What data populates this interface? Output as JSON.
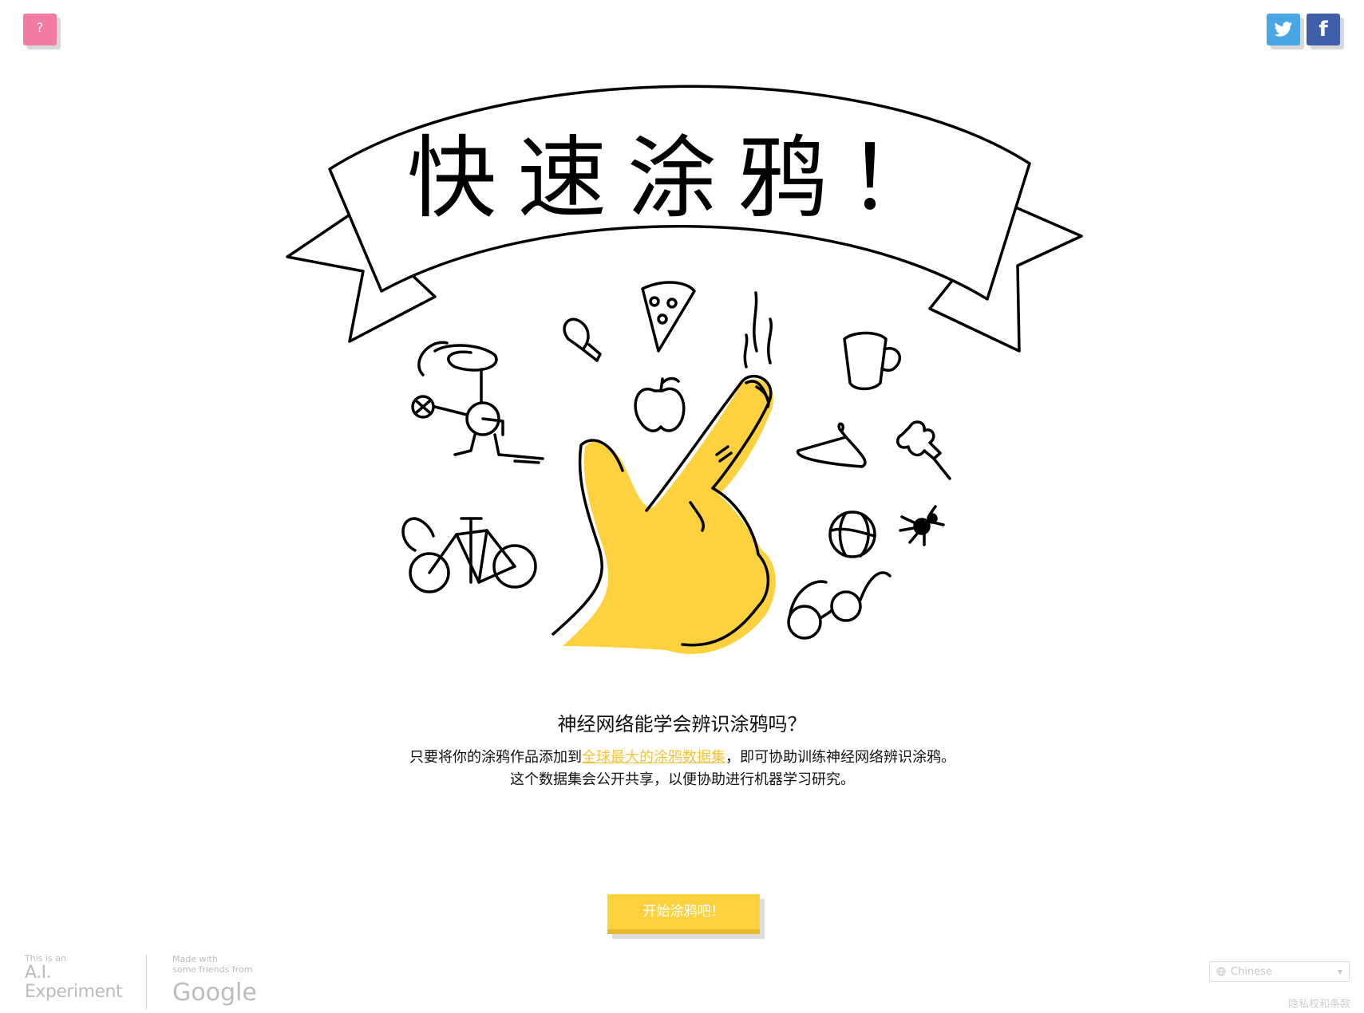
{
  "header": {
    "help_label": "?",
    "facebook_label": "f"
  },
  "hero": {
    "title": "快速涂鸦！"
  },
  "intro": {
    "headline": "神经网络能学会辨识涂鸦吗？",
    "desc_before": "只要将你的涂鸦作品添加到",
    "desc_link": "全球最大的涂鸦数据集",
    "desc_after": "，即可协助训练神经网络辨识涂鸦。这个数据集会公开共享，以便协助进行机器学习研究。"
  },
  "start_button": "开始涂鸦吧！",
  "footer": {
    "ai_small": "This is an",
    "ai_line1": "A.I.",
    "ai_line2": "Experiment",
    "google_small1": "Made with",
    "google_small2": "some friends from",
    "google_name": "Google",
    "language": "Chinese",
    "privacy": "隐私权和条款"
  },
  "colors": {
    "accent_yellow": "#fdd23e",
    "help_pink": "#f27aa5",
    "twitter_blue": "#48a7e4",
    "facebook_blue": "#3f60a8"
  }
}
